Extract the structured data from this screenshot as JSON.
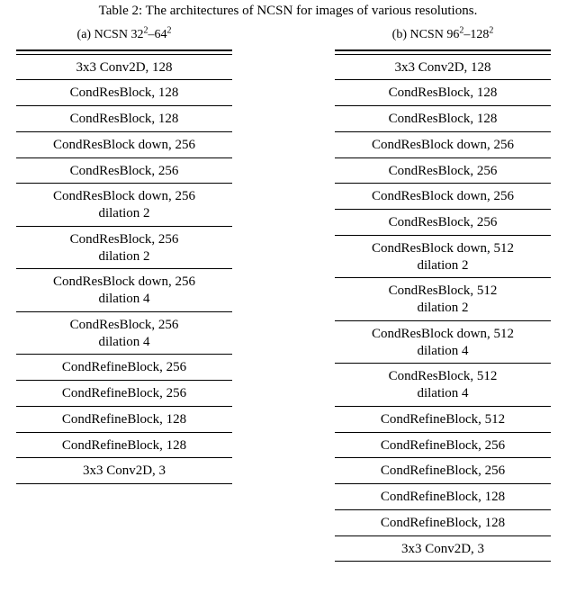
{
  "caption_prefix": "Table 2: ",
  "caption_text": "The architectures of NCSN for images of various resolutions.",
  "left": {
    "sub_label": "(a) NCSN ",
    "sub_range_a": "32",
    "sub_range_b": "64",
    "sup": "2",
    "rows": [
      "3x3 Conv2D, 128",
      "CondResBlock, 128",
      "CondResBlock, 128",
      "CondResBlock down, 256",
      "CondResBlock, 256",
      "CondResBlock down, 256\ndilation 2",
      "CondResBlock, 256\ndilation 2",
      "CondResBlock down, 256\ndilation 4",
      "CondResBlock, 256\ndilation 4",
      "CondRefineBlock, 256",
      "CondRefineBlock, 256",
      "CondRefineBlock, 128",
      "CondRefineBlock, 128",
      "3x3 Conv2D, 3"
    ]
  },
  "right": {
    "sub_label": "(b) NCSN ",
    "sub_range_a": "96",
    "sub_range_b": "128",
    "sup": "2",
    "rows": [
      "3x3 Conv2D, 128",
      "CondResBlock, 128",
      "CondResBlock, 128",
      "CondResBlock down, 256",
      "CondResBlock, 256",
      "CondResBlock down, 256",
      "CondResBlock, 256",
      "CondResBlock down, 512\ndilation 2",
      "CondResBlock, 512\ndilation 2",
      "CondResBlock down, 512\ndilation 4",
      "CondResBlock, 512\ndilation 4",
      "CondRefineBlock, 512",
      "CondRefineBlock, 256",
      "CondRefineBlock, 256",
      "CondRefineBlock, 128",
      "CondRefineBlock, 128",
      "3x3 Conv2D, 3"
    ]
  },
  "chart_data": [
    {
      "type": "table",
      "title": "(a) NCSN 32^2–64^2",
      "rows": [
        "3x3 Conv2D, 128",
        "CondResBlock, 128",
        "CondResBlock, 128",
        "CondResBlock down, 256",
        "CondResBlock, 256",
        "CondResBlock down, 256 dilation 2",
        "CondResBlock, 256 dilation 2",
        "CondResBlock down, 256 dilation 4",
        "CondResBlock, 256 dilation 4",
        "CondRefineBlock, 256",
        "CondRefineBlock, 256",
        "CondRefineBlock, 128",
        "CondRefineBlock, 128",
        "3x3 Conv2D, 3"
      ]
    },
    {
      "type": "table",
      "title": "(b) NCSN 96^2–128^2",
      "rows": [
        "3x3 Conv2D, 128",
        "CondResBlock, 128",
        "CondResBlock, 128",
        "CondResBlock down, 256",
        "CondResBlock, 256",
        "CondResBlock down, 256",
        "CondResBlock, 256",
        "CondResBlock down, 512 dilation 2",
        "CondResBlock, 512 dilation 2",
        "CondResBlock down, 512 dilation 4",
        "CondResBlock, 512 dilation 4",
        "CondRefineBlock, 512",
        "CondRefineBlock, 256",
        "CondRefineBlock, 256",
        "CondRefineBlock, 128",
        "CondRefineBlock, 128",
        "3x3 Conv2D, 3"
      ]
    }
  ]
}
